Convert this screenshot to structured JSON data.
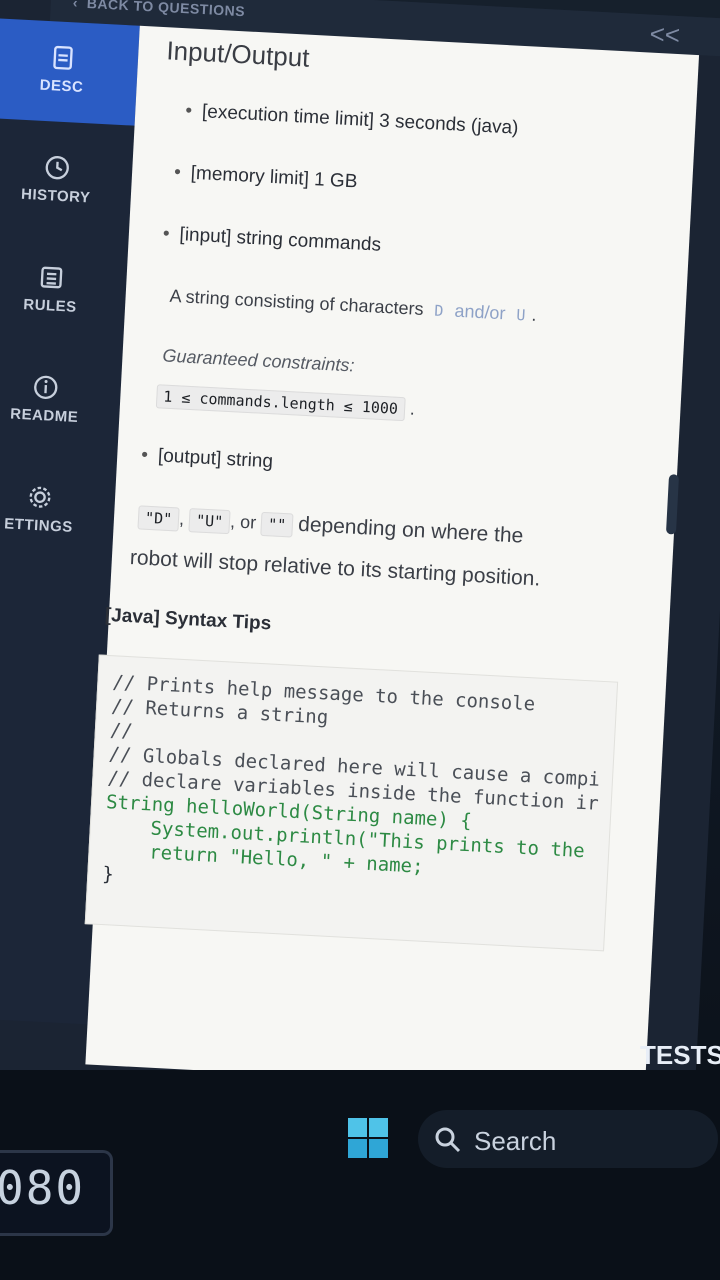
{
  "topbar": {
    "back_label": "BACK TO QUESTIONS",
    "collapse_label": "<<"
  },
  "sidebar": {
    "items": [
      {
        "label": "DESC",
        "icon": "file-icon",
        "active": true
      },
      {
        "label": "HISTORY",
        "icon": "clock-icon",
        "active": false
      },
      {
        "label": "RULES",
        "icon": "list-icon",
        "active": false
      },
      {
        "label": "README",
        "icon": "info-icon",
        "active": false
      },
      {
        "label": "ETTINGS",
        "icon": "gear-icon",
        "active": false
      }
    ]
  },
  "content": {
    "title": "Input/Output",
    "exec_limit": "[execution time limit] 3 seconds (java)",
    "memory_limit": "[memory limit] 1 GB",
    "input": "[input] string commands",
    "input_desc_prefix": "A string consisting of characters",
    "input_char1": "D",
    "input_desc_mid": "and/or",
    "input_char2": "U",
    "input_desc_suffix": ".",
    "constraints_label": "Guaranteed constraints:",
    "constraint": "1 ≤ commands.length ≤ 1000",
    "constraint_suffix": ".",
    "output": "[output] string",
    "output_d": "\"D\"",
    "output_u": "\"U\"",
    "output_or": ", or",
    "output_empty": "\"\"",
    "output_desc": "depending on where the",
    "output_desc2": "robot will stop relative to its starting position.",
    "syntax_title": "[Java] Syntax Tips",
    "code": [
      "// Prints help message to the console",
      "// Returns a string",
      "//",
      "// Globals declared here will cause a compi",
      "// declare variables inside the function ir",
      "String helloWorld(String name) {",
      "    System.out.println(\"This prints to the",
      "    return \"Hello, \" + name;",
      "}"
    ]
  },
  "tests_tab": "TESTS",
  "taskbar": {
    "search_label": "Search",
    "counter": "080"
  }
}
